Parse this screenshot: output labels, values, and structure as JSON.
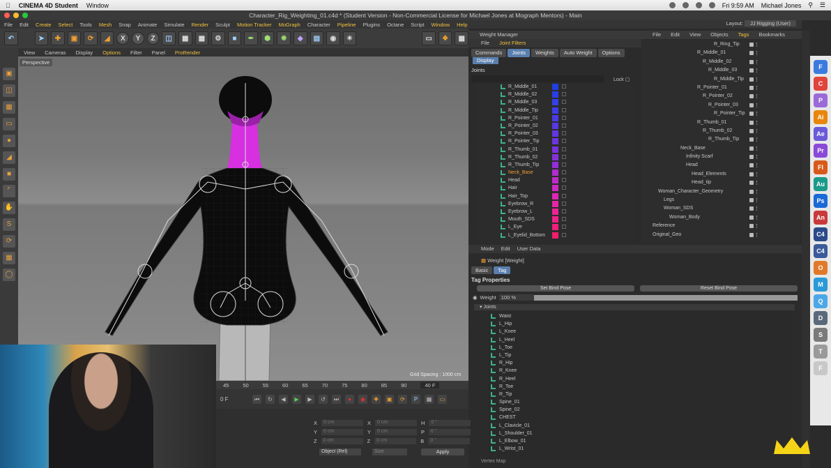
{
  "mac_menubar": {
    "app_name": "CINEMA 4D Student",
    "window_menu": "Window",
    "time": "Fri 9:59 AM",
    "user": "Michael Jones"
  },
  "window_title": "Character_Rig_Weighting_01.c4d * (Student Version - Non-Commercial License for Michael Jones at Mograph Mentors) - Main",
  "app_menu": [
    "File",
    "Edit",
    "Create",
    "Select",
    "Tools",
    "Mesh",
    "Snap",
    "Animate",
    "Simulate",
    "Render",
    "Sculpt",
    "Motion Tracker",
    "MoGraph",
    "Character",
    "Pipeline",
    "Plugins",
    "Octane",
    "Script",
    "Window",
    "Help"
  ],
  "layout_label": "Layout:",
  "layout_value": "JJ Rigging (User)",
  "viewport_menu": [
    "View",
    "Cameras",
    "Display",
    "Options",
    "Filter",
    "Panel",
    "ProRender"
  ],
  "viewport_label": "Perspective",
  "grid_spacing": "Grid Spacing : 1000 cm",
  "timeline_ticks": [
    "45",
    "50",
    "55",
    "60",
    "65",
    "70",
    "75",
    "80",
    "85",
    "90"
  ],
  "timeline_end": "40 F",
  "timeline_start": "0 F",
  "coords": {
    "x": "X",
    "y": "Y",
    "z": "Z",
    "x_val": "0 cm",
    "y_val": "0 cm",
    "z_val": "0 cm",
    "x2": "X",
    "y2": "Y",
    "z2": "Z",
    "h": "H",
    "p": "P",
    "b": "B",
    "h_val": "0 °",
    "p_val": "0 °",
    "b_val": "0 °",
    "object_rel": "Object (Rel)",
    "size": "Size",
    "apply": "Apply"
  },
  "weight_manager": {
    "title": "Weight Manager",
    "menu": [
      "File",
      "Joint Filters"
    ],
    "tabs": [
      "Commands",
      "Joints",
      "Weights",
      "Auto Weight",
      "Options"
    ],
    "active_tab": "Joints",
    "display_tab": "Display",
    "joints_header": "Joints",
    "lock_label": "Lock",
    "joints": [
      {
        "name": "R_Middle_01",
        "color": "#1f3fe0"
      },
      {
        "name": "R_Middle_02",
        "color": "#2a3ee8"
      },
      {
        "name": "R_Middle_03",
        "color": "#3440e8"
      },
      {
        "name": "R_Middle_Tip",
        "color": "#3e3ce8"
      },
      {
        "name": "R_Pointer_01",
        "color": "#4a3ae6"
      },
      {
        "name": "R_Pointer_02",
        "color": "#5638e4"
      },
      {
        "name": "R_Pointer_03",
        "color": "#6236e2"
      },
      {
        "name": "R_Pointer_Tip",
        "color": "#6e34e0"
      },
      {
        "name": "R_Thumb_01",
        "color": "#7a32de"
      },
      {
        "name": "R_Thumb_02",
        "color": "#8630dc"
      },
      {
        "name": "R_Thumb_Tip",
        "color": "#922eda"
      },
      {
        "name": "Neck_Base",
        "color": "#b02cd0",
        "highlight": true
      },
      {
        "name": "Head",
        "color": "#c02ac8"
      },
      {
        "name": "Hair",
        "color": "#d028c0"
      },
      {
        "name": "Hair_Top",
        "color": "#de26b4"
      },
      {
        "name": "Eyebrow_R",
        "color": "#e824a6"
      },
      {
        "name": "Eyebrow_L",
        "color": "#ec2298"
      },
      {
        "name": "Mouth_SDS",
        "color": "#f0208a"
      },
      {
        "name": "L_Eye",
        "color": "#f01e7c"
      },
      {
        "name": "L_Eyelid_Bottom",
        "color": "#f01c6e"
      }
    ]
  },
  "object_manager": {
    "menu": [
      "File",
      "Edit",
      "View",
      "Objects",
      "Tags",
      "Bookmarks"
    ],
    "active_menu": "Tags",
    "rows": [
      {
        "name": "R_Ring_Tip",
        "indent": 92
      },
      {
        "name": "R_Middle_01",
        "indent": 68
      },
      {
        "name": "R_Middle_02",
        "indent": 76
      },
      {
        "name": "R_Middle_03",
        "indent": 84
      },
      {
        "name": "R_Middle_Tip",
        "indent": 92
      },
      {
        "name": "R_Pointer_01",
        "indent": 68
      },
      {
        "name": "R_Pointer_02",
        "indent": 76
      },
      {
        "name": "R_Pointer_03",
        "indent": 84
      },
      {
        "name": "R_Pointer_Tip",
        "indent": 92
      },
      {
        "name": "R_Thumb_01",
        "indent": 68
      },
      {
        "name": "R_Thumb_02",
        "indent": 76
      },
      {
        "name": "R_Thumb_Tip",
        "indent": 84
      },
      {
        "name": "Neck_Base",
        "indent": 44
      },
      {
        "name": "Infinity Scarf",
        "indent": 52
      },
      {
        "name": "Head",
        "indent": 52
      },
      {
        "name": "Head_Elements",
        "indent": 60
      },
      {
        "name": "Head_tip",
        "indent": 60
      },
      {
        "name": "Woman_Character_Geometry",
        "indent": 12
      },
      {
        "name": "Legs",
        "indent": 20
      },
      {
        "name": "Woman_SDS",
        "indent": 20
      },
      {
        "name": "Woman_Body",
        "indent": 28
      },
      {
        "name": "Reference",
        "indent": 4
      },
      {
        "name": "Original_Geo",
        "indent": 4
      }
    ]
  },
  "attribute_manager": {
    "menu": [
      "Mode",
      "Edit",
      "User Data"
    ],
    "title": "Weight [Weight]",
    "tabs": [
      "Basic",
      "Tag"
    ],
    "active_tab": "Tag",
    "tag_properties": "Tag Properties",
    "set_bind_pose": "Set Bind Pose",
    "reset_bind_pose": "Reset Bind Pose",
    "weight_label": "Weight",
    "weight_value": "100 %",
    "weight_fraction": 1.0,
    "joints_label": "Joints",
    "joints": [
      "Waist",
      "L_Hip",
      "L_Knee",
      "L_Heel",
      "L_Toe",
      "L_Tip",
      "R_Hip",
      "R_Knee",
      "R_Heel",
      "R_Toe",
      "R_Tip",
      "Spine_01",
      "Spine_02",
      "CHEST",
      "L_Clavicle_01",
      "L_Shoulder_01",
      "L_Elbow_01",
      "L_Wrist_01"
    ],
    "vertex_map": "Vertex Map"
  },
  "dock_apps": [
    {
      "label": "F",
      "color": "#3b7be0"
    },
    {
      "label": "C",
      "color": "#e0443a"
    },
    {
      "label": "P",
      "color": "#9a6ad8"
    },
    {
      "label": "Ai",
      "color": "#e8860c"
    },
    {
      "label": "Ae",
      "color": "#6a5ad8"
    },
    {
      "label": "Pr",
      "color": "#8a4ad8"
    },
    {
      "label": "Fl",
      "color": "#d85a1a"
    },
    {
      "label": "Au",
      "color": "#1a9a8a"
    },
    {
      "label": "Ps",
      "color": "#1a6ad8"
    },
    {
      "label": "An",
      "color": "#c83a3a"
    },
    {
      "label": "C4",
      "color": "#2a4a8a"
    },
    {
      "label": "C4",
      "color": "#3a5a9a"
    },
    {
      "label": "O",
      "color": "#e07a2a"
    },
    {
      "label": "M",
      "color": "#2a9ad8"
    },
    {
      "label": "Q",
      "color": "#4aa8e8"
    },
    {
      "label": "D",
      "color": "#5a6a7a"
    },
    {
      "label": "S",
      "color": "#7a7a7a"
    },
    {
      "label": "T",
      "color": "#9a9a9a"
    },
    {
      "label": "F",
      "color": "#c8c8c8"
    }
  ]
}
